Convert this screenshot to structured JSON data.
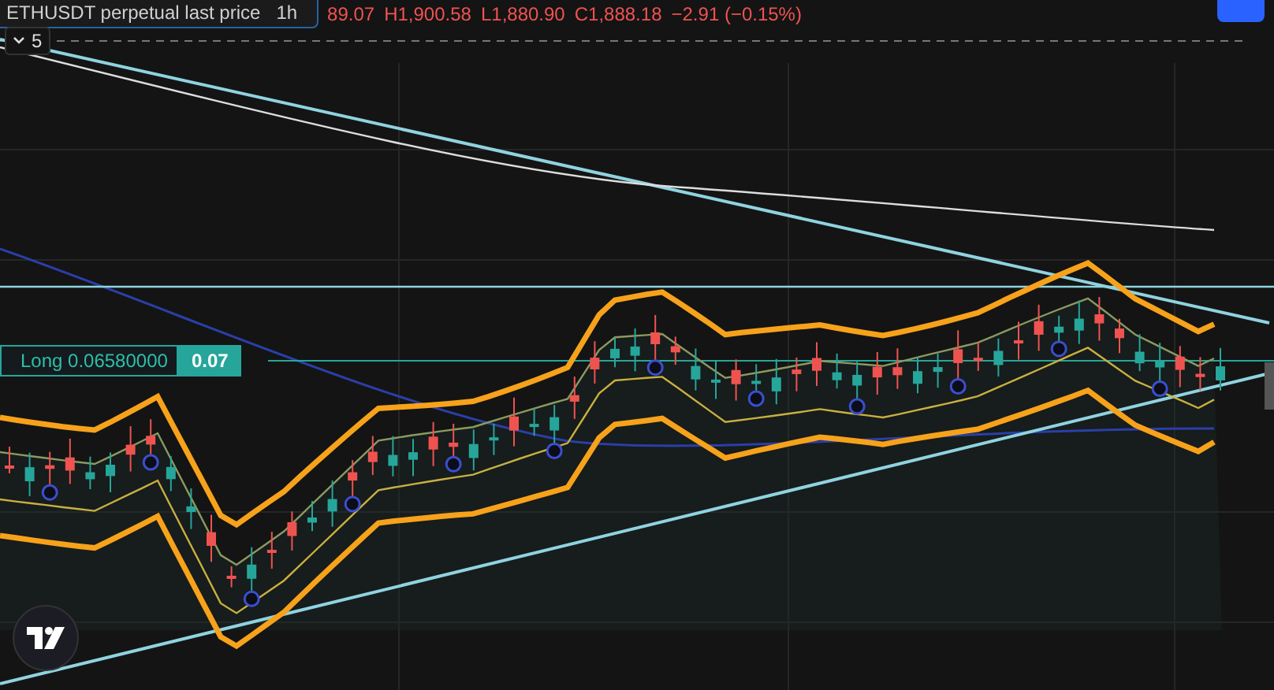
{
  "header": {
    "symbol": "ETHUSDT perpetual last price",
    "interval": "1h",
    "ohlc": [
      "89.07",
      "H1,900.58",
      "L1,880.90",
      "C1,888.18",
      "−2.91 (−0.15%)"
    ]
  },
  "indicator_toggle": {
    "count": "5"
  },
  "position": {
    "label": "Long 0.06580000",
    "quantity": "0.07"
  }
}
